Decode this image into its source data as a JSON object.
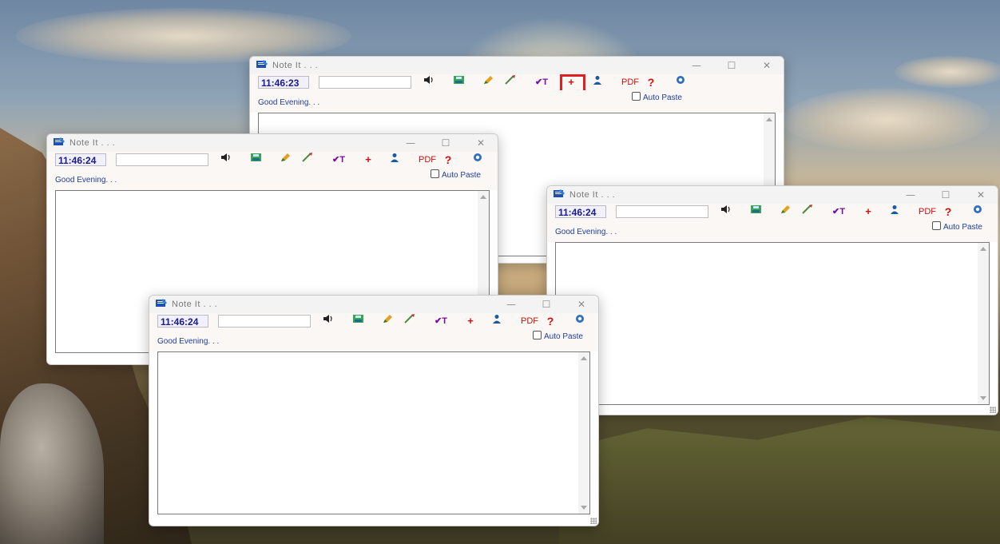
{
  "app": {
    "title": "Note It . . .",
    "greeting": "Good Evening. . .",
    "auto_paste_label": "Auto Paste",
    "search_placeholder": ""
  },
  "controls": {
    "minimize": "—",
    "maximize": "☐",
    "close": "✕"
  },
  "toolbar": {
    "sound_icon": "speaker-icon",
    "save_icon": "save-icon",
    "edit_icon": "pencil-icon",
    "color_icon": "pen-icon",
    "spellcheck_label": "✔T",
    "new_label": "+",
    "user_icon": "user-icon",
    "pdf_label": "PDF",
    "help_label": "?",
    "settings_icon": "gear-icon"
  },
  "windows": [
    {
      "id": "window-1",
      "time": "11:46:23"
    },
    {
      "id": "window-2",
      "time": "11:46:24"
    },
    {
      "id": "window-3",
      "time": "11:46:24"
    },
    {
      "id": "window-4",
      "time": "11:46:24"
    }
  ],
  "colors": {
    "highlight": "#e02020",
    "clock_text": "#1b1b8a",
    "greeting_text": "#1d3e9a",
    "pdf_red": "#cc1111"
  }
}
